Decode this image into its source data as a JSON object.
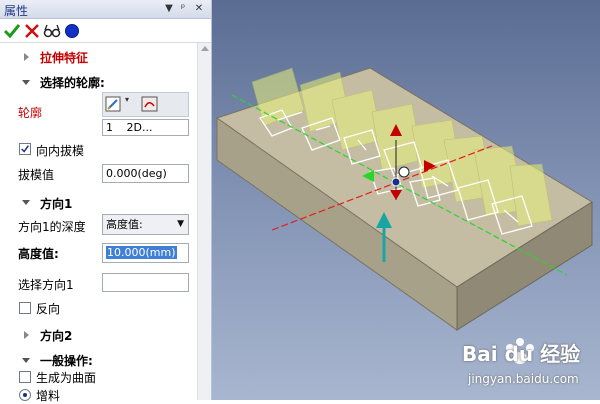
{
  "panel": {
    "title": "属性",
    "title_buttons": [
      "▼",
      "ᵖ",
      "✕"
    ],
    "feature_name": "拉伸特征",
    "selected_profile_header": "选择的轮廓:",
    "profile_label": "轮廓",
    "profile_value_index": "1",
    "profile_value_type": "2D...",
    "inward_draft_label": "向内拔模",
    "inward_draft_checked": true,
    "draft_value_label": "拔模值",
    "draft_value": "0.000(deg)",
    "direction1_header": "方向1",
    "depth_label": "方向1的深度",
    "depth_value": "高度值:",
    "height_label": "高度值:",
    "height_value": "10.000(mm)",
    "select_direction_label": "选择方向1",
    "select_direction_value": "",
    "reverse_label": "反向",
    "reverse_checked": false,
    "direction2_header": "方向2",
    "general_ops_header": "一般操作:",
    "make_surface_label": "生成为曲面",
    "make_surface_checked": false,
    "add_material_label": "增料"
  },
  "colors": {
    "ok": "#1a9c1a",
    "cancel": "#d01010",
    "feature_red": "#c40000",
    "selection_blue": "#3f7fd6",
    "viewport_top": "#5a6c92",
    "plate_top": "#c4bda4"
  },
  "icons": {
    "ok": "check-icon",
    "cancel": "x-icon",
    "preview": "glasses-icon",
    "status": "blue-dot-icon"
  },
  "watermark": {
    "brand": "Bai du 经验",
    "site": "jingyan.baidu.com"
  }
}
